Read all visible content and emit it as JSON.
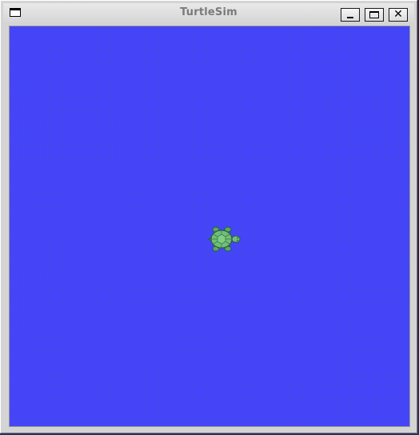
{
  "window": {
    "title": "TurtleSim",
    "buttons": {
      "minimize": "minimize",
      "maximize": "maximize",
      "close": "✕"
    }
  },
  "canvas": {
    "background_color": "#4545ff"
  },
  "turtle": {
    "icon": "turtle-icon",
    "heading": "east",
    "shell_color": "#6fbf78",
    "outline_color": "#2d5e38"
  }
}
